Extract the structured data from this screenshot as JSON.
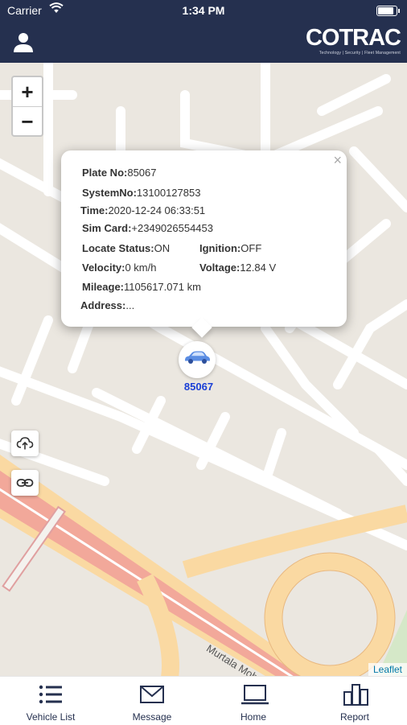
{
  "status_bar": {
    "carrier": "Carrier",
    "time": "1:34 PM",
    "battery_level": 0.95
  },
  "header": {
    "brand": "COTRAC",
    "tagline": "Technology | Security | Fleet Management",
    "user_icon": "user-icon"
  },
  "map": {
    "zoom_in": "+",
    "zoom_out": "−",
    "road_label": "Murtala Moham",
    "attribution": "Leaflet",
    "controls": [
      "cloud-upload-icon",
      "link-icon"
    ]
  },
  "popup": {
    "close": "×",
    "plate_label": "Plate No:",
    "plate_value": "85067",
    "system_label": "SystemNo:",
    "system_value": "13100127853",
    "time_label": "Time:",
    "time_value": "2020-12-24 06:33:51",
    "sim_label": "Sim Card:",
    "sim_value": "+2349026554453",
    "locate_label": "Locate Status:",
    "locate_value": "ON",
    "ignition_label": "Ignition:",
    "ignition_value": "OFF",
    "velocity_label": "Velocity:",
    "velocity_value": "0 km/h",
    "voltage_label": "Voltage:",
    "voltage_value": "12.84 V",
    "mileage_label": "Mileage:",
    "mileage_value": "1105617.071 km",
    "address_label": "Address:",
    "address_value": "..."
  },
  "vehicle_marker": {
    "label": "85067",
    "icon": "car-icon",
    "color": "#1a3fd6"
  },
  "tabs": [
    {
      "label": "Vehicle List",
      "icon": "list-icon"
    },
    {
      "label": "Message",
      "icon": "envelope-icon"
    },
    {
      "label": "Home",
      "icon": "laptop-icon"
    },
    {
      "label": "Report",
      "icon": "bar-chart-icon"
    }
  ],
  "colors": {
    "header_bg": "#25304f",
    "map_bg": "#ebe7e0",
    "road": "#ffffff",
    "highway": "#f2a89a",
    "ramp": "#fad9a2"
  }
}
